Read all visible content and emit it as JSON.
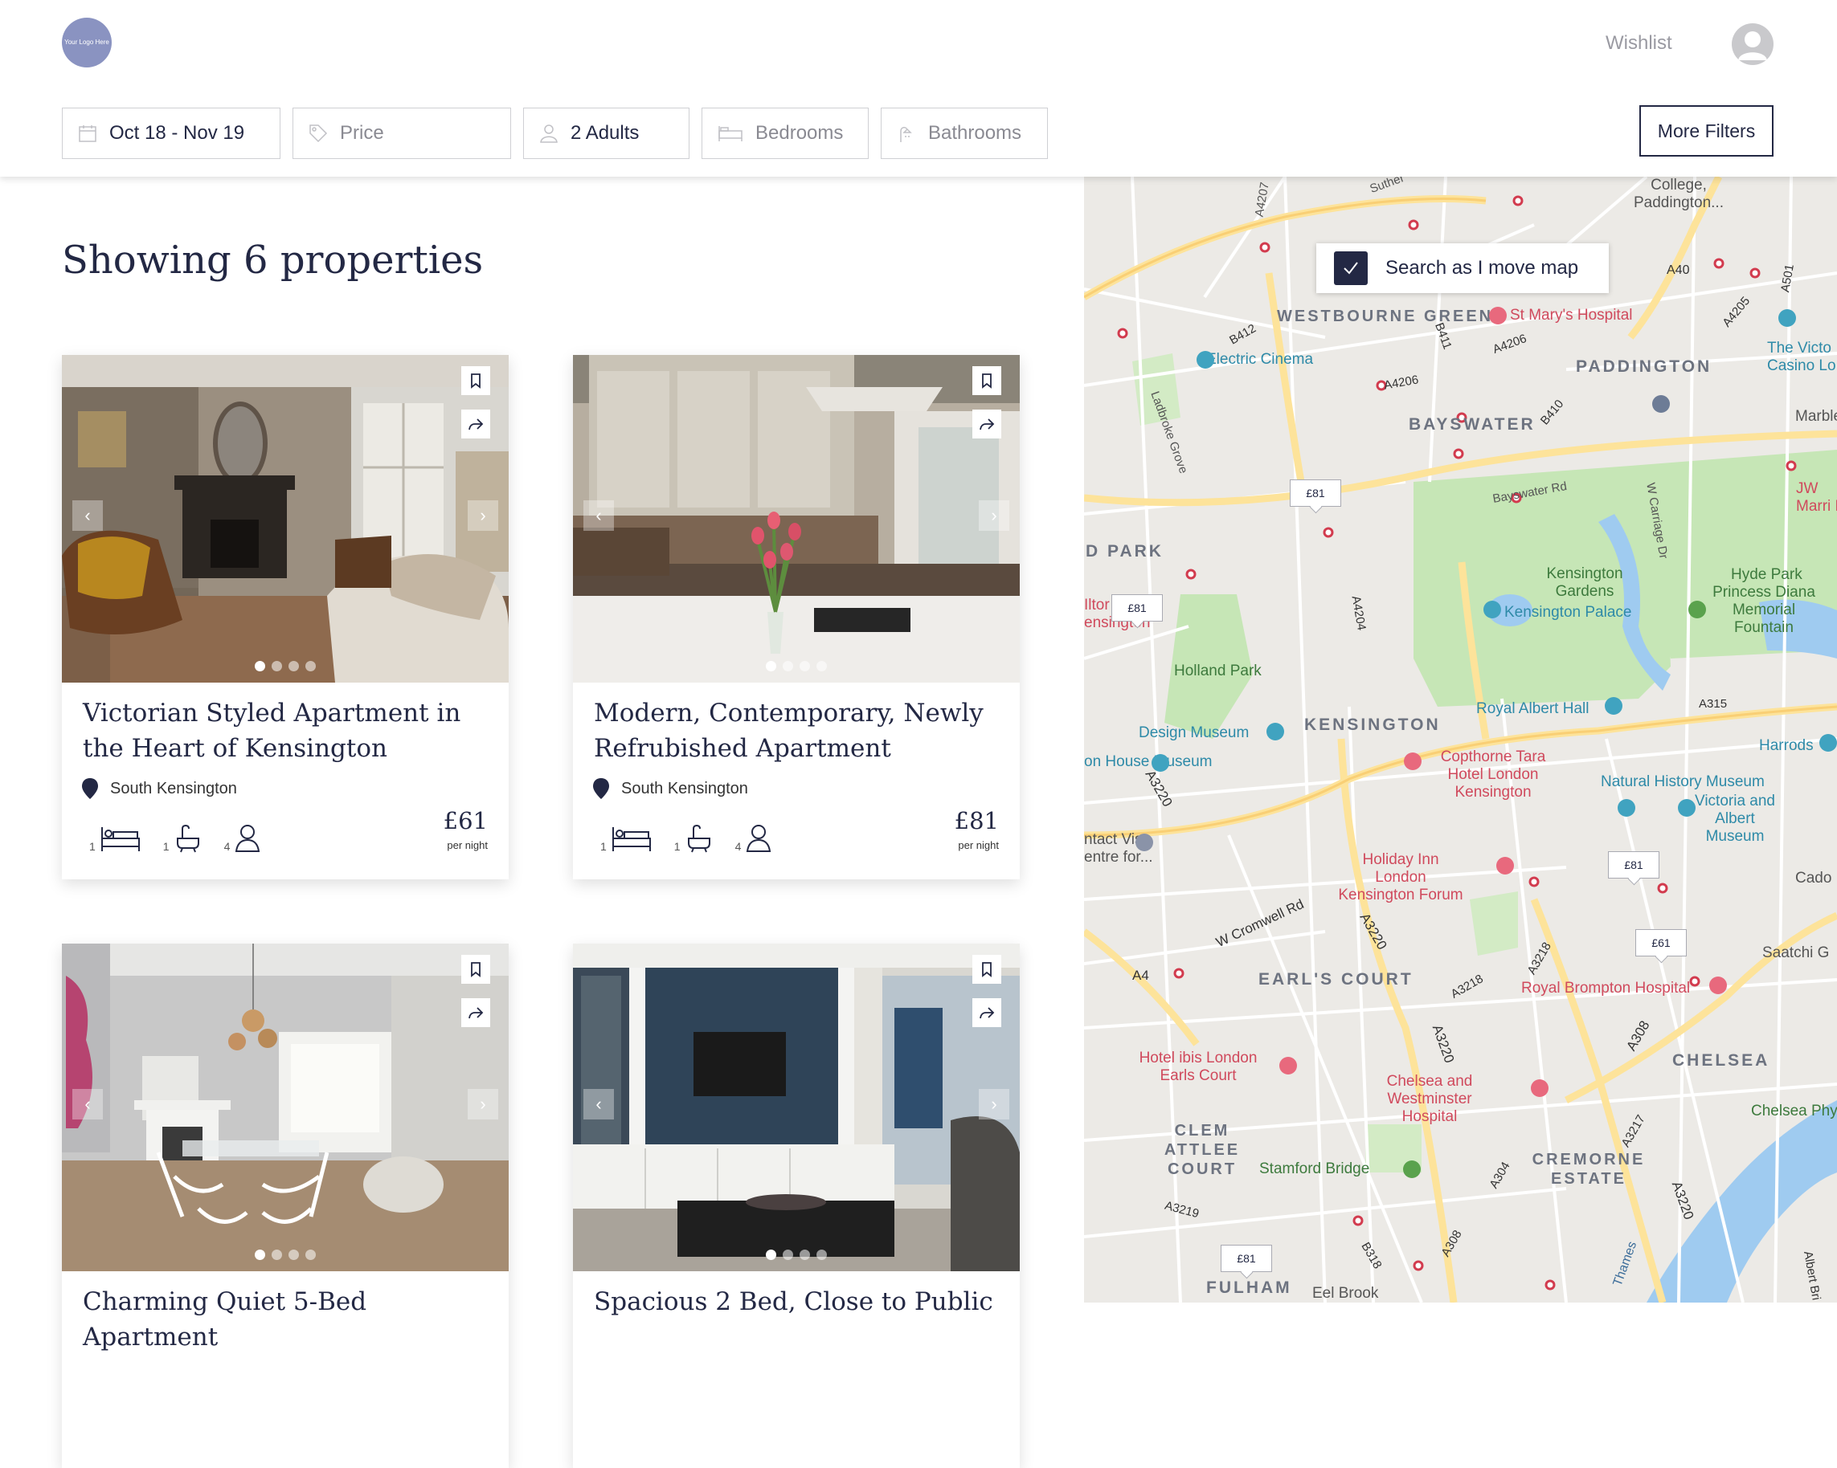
{
  "header": {
    "logo_text": "Your Logo Here",
    "wishlist_label": "Wishlist"
  },
  "filters": {
    "dates": "Oct 18 - Nov 19",
    "price_placeholder": "Price",
    "guests": "2 Adults",
    "bedrooms_placeholder": "Bedrooms",
    "bathrooms_placeholder": "Bathrooms",
    "more_filters_label": "More Filters"
  },
  "results": {
    "title": "Showing 6 properties"
  },
  "listings": [
    {
      "title": "Victorian Styled Apartment in the Heart of Kensington",
      "location": "South Kensington",
      "bedrooms": "1",
      "bathrooms": "1",
      "guests": "4",
      "price": "£61",
      "price_unit": "per night",
      "photo_dots": 4,
      "active_dot": 0
    },
    {
      "title": "Modern, Contemporary, Newly Refrubished Apartment",
      "location": "South Kensington",
      "bedrooms": "1",
      "bathrooms": "1",
      "guests": "4",
      "price": "£81",
      "price_unit": "per night",
      "photo_dots": 4,
      "active_dot": 0
    },
    {
      "title": "Charming Quiet 5-Bed Apartment",
      "photo_dots": 4,
      "active_dot": 0
    },
    {
      "title": "Spacious 2 Bed, Close to Public",
      "photo_dots": 4,
      "active_dot": 0
    }
  ],
  "map": {
    "search_as_move_label": "Search as I move map",
    "price_markers": [
      "£81",
      "£81",
      "£81",
      "£61",
      "£81"
    ],
    "area_labels": [
      "WESTBOURNE GREEN",
      "PADDINGTON",
      "BAYSWATER",
      "D PARK",
      "KENSINGTON",
      "EARL'S COURT",
      "CHELSEA",
      "CLEM ATTLEE COURT",
      "CREMORNE ESTATE",
      "FULHAM"
    ],
    "places": [
      "College, Paddington...",
      "St Mary's Hospital",
      "Electric Cinema",
      "The Victo Casino Lo",
      "Marble",
      "JW Marri H",
      "Kensington Gardens",
      "Kensington Palace",
      "Hyde Park",
      "Princess Diana Memorial Fountain",
      "Holland Park",
      "Royal Albert Hall",
      "Design Museum",
      "Harrods",
      "Copthorne Tara Hotel London Kensington",
      "on House Museum",
      "Natural History Museum",
      "Victoria and Albert Museum",
      "ntact Visa entre for...",
      "Holiday Inn London Kensington Forum",
      "Cado",
      "Saatchi G",
      "Royal Brompton Hospital",
      "Hotel ibis London Earls Court",
      "Chelsea and Westminster Hospital",
      "Chelsea Phy",
      "Stamford Bridge",
      "Eel Brook",
      "Iltor ensington"
    ],
    "roads": [
      "A4207",
      "Suther",
      "A40",
      "A4205",
      "A501",
      "B412",
      "B411",
      "A4206",
      "A4206",
      "B410",
      "Ladbroke Grove",
      "Bayswater Rd",
      "W Carriage Dr",
      "A4204",
      "A315",
      "A3220",
      "A4",
      "W Cromwell Rd",
      "A3220",
      "A3218",
      "A3220",
      "A308",
      "A3217",
      "A304",
      "A3219",
      "B318",
      "A308",
      "Thames",
      "A3220",
      "Albert Bri",
      "A3218"
    ]
  },
  "colors": {
    "navy": "#232844",
    "logo": "#8a93c1",
    "park": "#c6e6b6",
    "water": "#9fcbf0",
    "major_road": "#fde39a"
  }
}
